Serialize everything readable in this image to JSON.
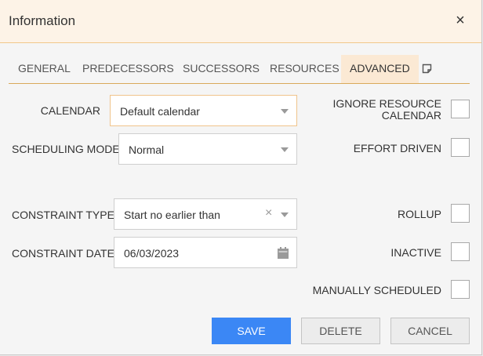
{
  "dialog": {
    "title": "Information",
    "close_symbol": "×"
  },
  "tabs": [
    {
      "label": "GENERAL"
    },
    {
      "label": "PREDECESSORS"
    },
    {
      "label": "SUCCESSORS"
    },
    {
      "label": "RESOURCES"
    },
    {
      "label": "ADVANCED",
      "active": true
    }
  ],
  "fields": {
    "calendar": {
      "label": "CALENDAR",
      "value": "Default calendar"
    },
    "scheduling_mode": {
      "label": "SCHEDULING MODE",
      "value": "Normal"
    },
    "constraint_type": {
      "label": "CONSTRAINT TYPE",
      "value": "Start no earlier than",
      "clear_symbol": "×"
    },
    "constraint_date": {
      "label": "CONSTRAINT DATE",
      "value": "06/03/2023"
    }
  },
  "checkboxes": {
    "ignore_resource_calendar": {
      "label_line1": "IGNORE RESOURCE",
      "label_line2": "CALENDAR",
      "checked": false
    },
    "effort_driven": {
      "label": "EFFORT DRIVEN",
      "checked": false
    },
    "rollup": {
      "label": "ROLLUP",
      "checked": false
    },
    "inactive": {
      "label": "INACTIVE",
      "checked": false
    },
    "manually_scheduled": {
      "label": "MANUALLY SCHEDULED",
      "checked": false
    }
  },
  "buttons": {
    "save": "SAVE",
    "delete": "DELETE",
    "cancel": "CANCEL"
  },
  "colors": {
    "accent": "#3b87f5",
    "header_bg": "#fdf3e7",
    "active_tab_bg": "#fbe9d4",
    "tab_underline": "#d9a95a"
  }
}
